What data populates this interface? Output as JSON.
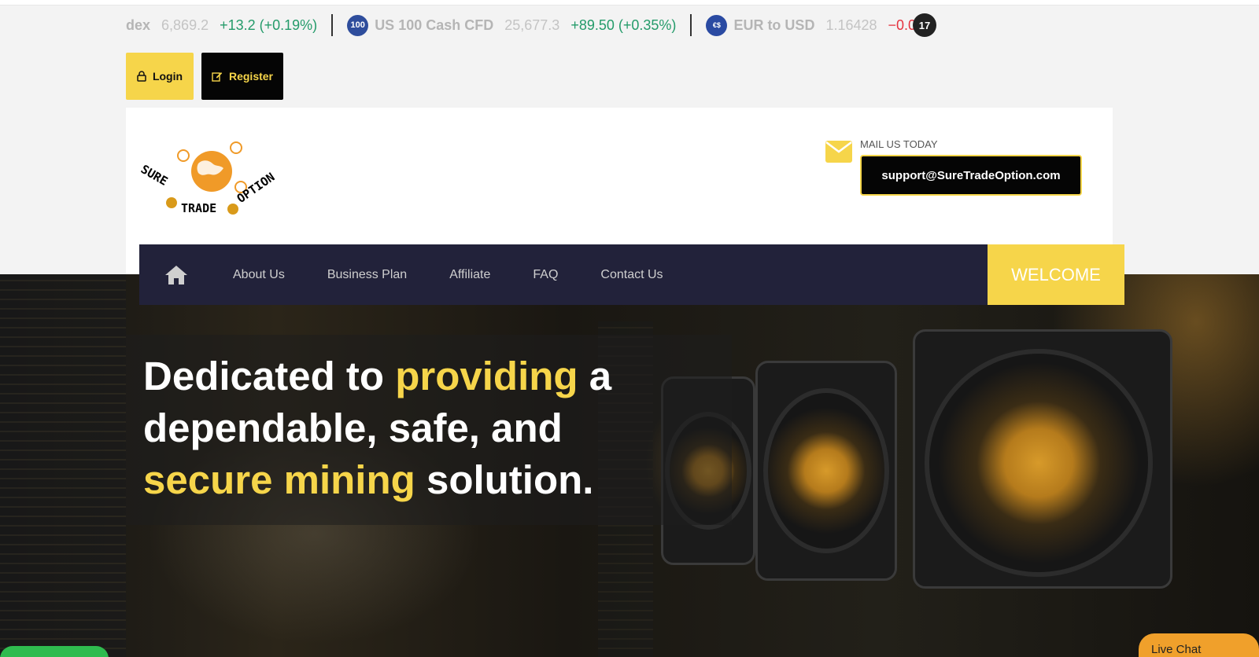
{
  "ticker": {
    "items": [
      {
        "logo": "",
        "name": "dex",
        "price": "6,869.2",
        "change": "+13.2 (+0.19%)",
        "direction": "up"
      },
      {
        "logo": "100",
        "name": "US 100 Cash CFD",
        "price": "25,677.3",
        "change": "+89.50 (+0.35%)",
        "direction": "up"
      },
      {
        "logo": "€$",
        "name": "EUR to USD",
        "price": "1.16428",
        "change": "−0.00",
        "direction": "down"
      }
    ],
    "badge": "17"
  },
  "auth": {
    "login_label": "Login",
    "register_label": "Register"
  },
  "header": {
    "logo_text": [
      "SURE",
      "TRADE",
      "OPTION"
    ],
    "mail_caption": "MAIL US TODAY",
    "email": "support@SureTradeOption.com"
  },
  "nav": {
    "items": [
      "About Us",
      "Business Plan",
      "Affiliate",
      "FAQ",
      "Contact Us"
    ],
    "welcome_label": "WELCOME"
  },
  "hero": {
    "line1_a": "Dedicated to ",
    "line1_hl": "providing",
    "line1_b": " a",
    "line2": "dependable, safe, and",
    "line3_hl": "secure mining",
    "line3_b": " solution."
  },
  "widgets": {
    "live_chat_label": "Live Chat"
  },
  "colors": {
    "accent_yellow": "#f6d54a",
    "nav_bg": "#22223a",
    "up": "#249b6a",
    "down": "#e5323e"
  }
}
